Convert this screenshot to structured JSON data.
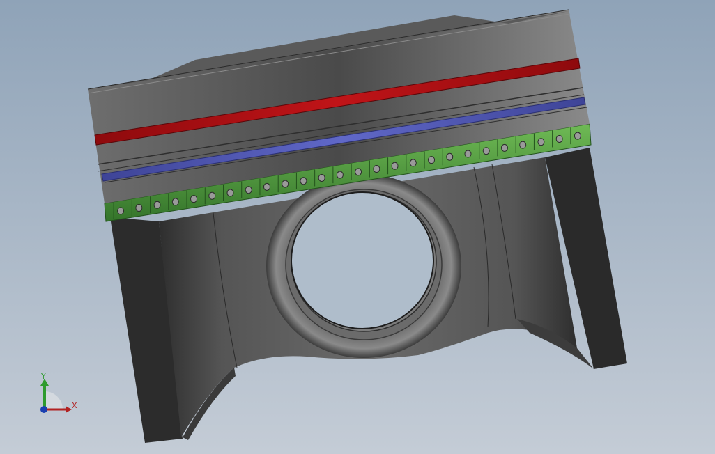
{
  "viewport": {
    "background_top": "#8fa3b8",
    "background_bottom": "#c4ccd6"
  },
  "model": {
    "body_color": "#4a4a4a",
    "ring_top_color": "#b30e12",
    "ring_middle_color": "#4f56b5",
    "ring_oil_color": "#4e9a3a"
  },
  "triad": {
    "x_label": "X",
    "y_label": "Y",
    "x_color": "#b22222",
    "y_color": "#2e9b2e",
    "z_color": "#1a3fb0"
  }
}
